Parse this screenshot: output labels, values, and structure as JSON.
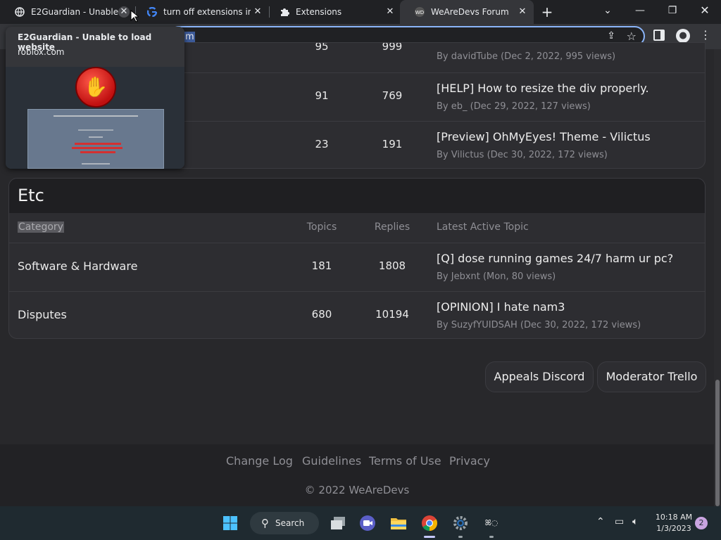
{
  "browser": {
    "tabs": [
      {
        "title": "E2Guardian - Unable to load website",
        "favicon": "globe-icon"
      },
      {
        "title": "turn off extensions in chrome - Google Search",
        "favicon": "google-icon"
      },
      {
        "title": "Extensions",
        "favicon": "puzzle-icon"
      },
      {
        "title": "WeAreDevs Forum",
        "favicon": "wearedevs-icon"
      }
    ],
    "omnibox_text": "m",
    "hover_card": {
      "title": "E2Guardian - Unable to load website",
      "url": "roblox.com"
    }
  },
  "forum": {
    "top_rows": [
      {
        "topics": "95",
        "replies": "999",
        "topic_title": "",
        "meta": "By davidTube (Dec 2, 2022, 995 views)"
      },
      {
        "topics": "91",
        "replies": "769",
        "topic_title": "[HELP] How to resize the div properly.",
        "meta": "By eb_ (Dec 29, 2022, 127 views)"
      },
      {
        "topics": "23",
        "replies": "191",
        "topic_title": "[Preview] OhMyEyes! Theme - Vilictus",
        "meta": "By Vilictus (Dec 30, 2022, 172 views)"
      }
    ],
    "etc": {
      "heading": "Etc",
      "columns": {
        "category": "Category",
        "topics": "Topics",
        "replies": "Replies",
        "latest": "Latest Active Topic"
      },
      "rows": [
        {
          "category": "Software & Hardware",
          "topics": "181",
          "replies": "1808",
          "topic_title": "[Q] dose running games 24/7 harm ur pc?",
          "meta": "By Jebxnt (Mon, 80 views)"
        },
        {
          "category": "Disputes",
          "topics": "680",
          "replies": "10194",
          "topic_title": "[OPINION] I hate nam3",
          "meta": "By SuzyfYUIDSAH (Dec 30, 2022, 172 views)"
        }
      ]
    },
    "buttons": {
      "appeals": "Appeals Discord",
      "moderator": "Moderator Trello"
    },
    "footer": {
      "links": [
        "Change Log",
        "Guidelines",
        "Terms of Use",
        "Privacy"
      ],
      "copyright": "© 2022 WeAreDevs"
    }
  },
  "taskbar": {
    "search_label": "Search",
    "time": "10:18 AM",
    "date": "1/3/2023",
    "notification_count": "2"
  }
}
